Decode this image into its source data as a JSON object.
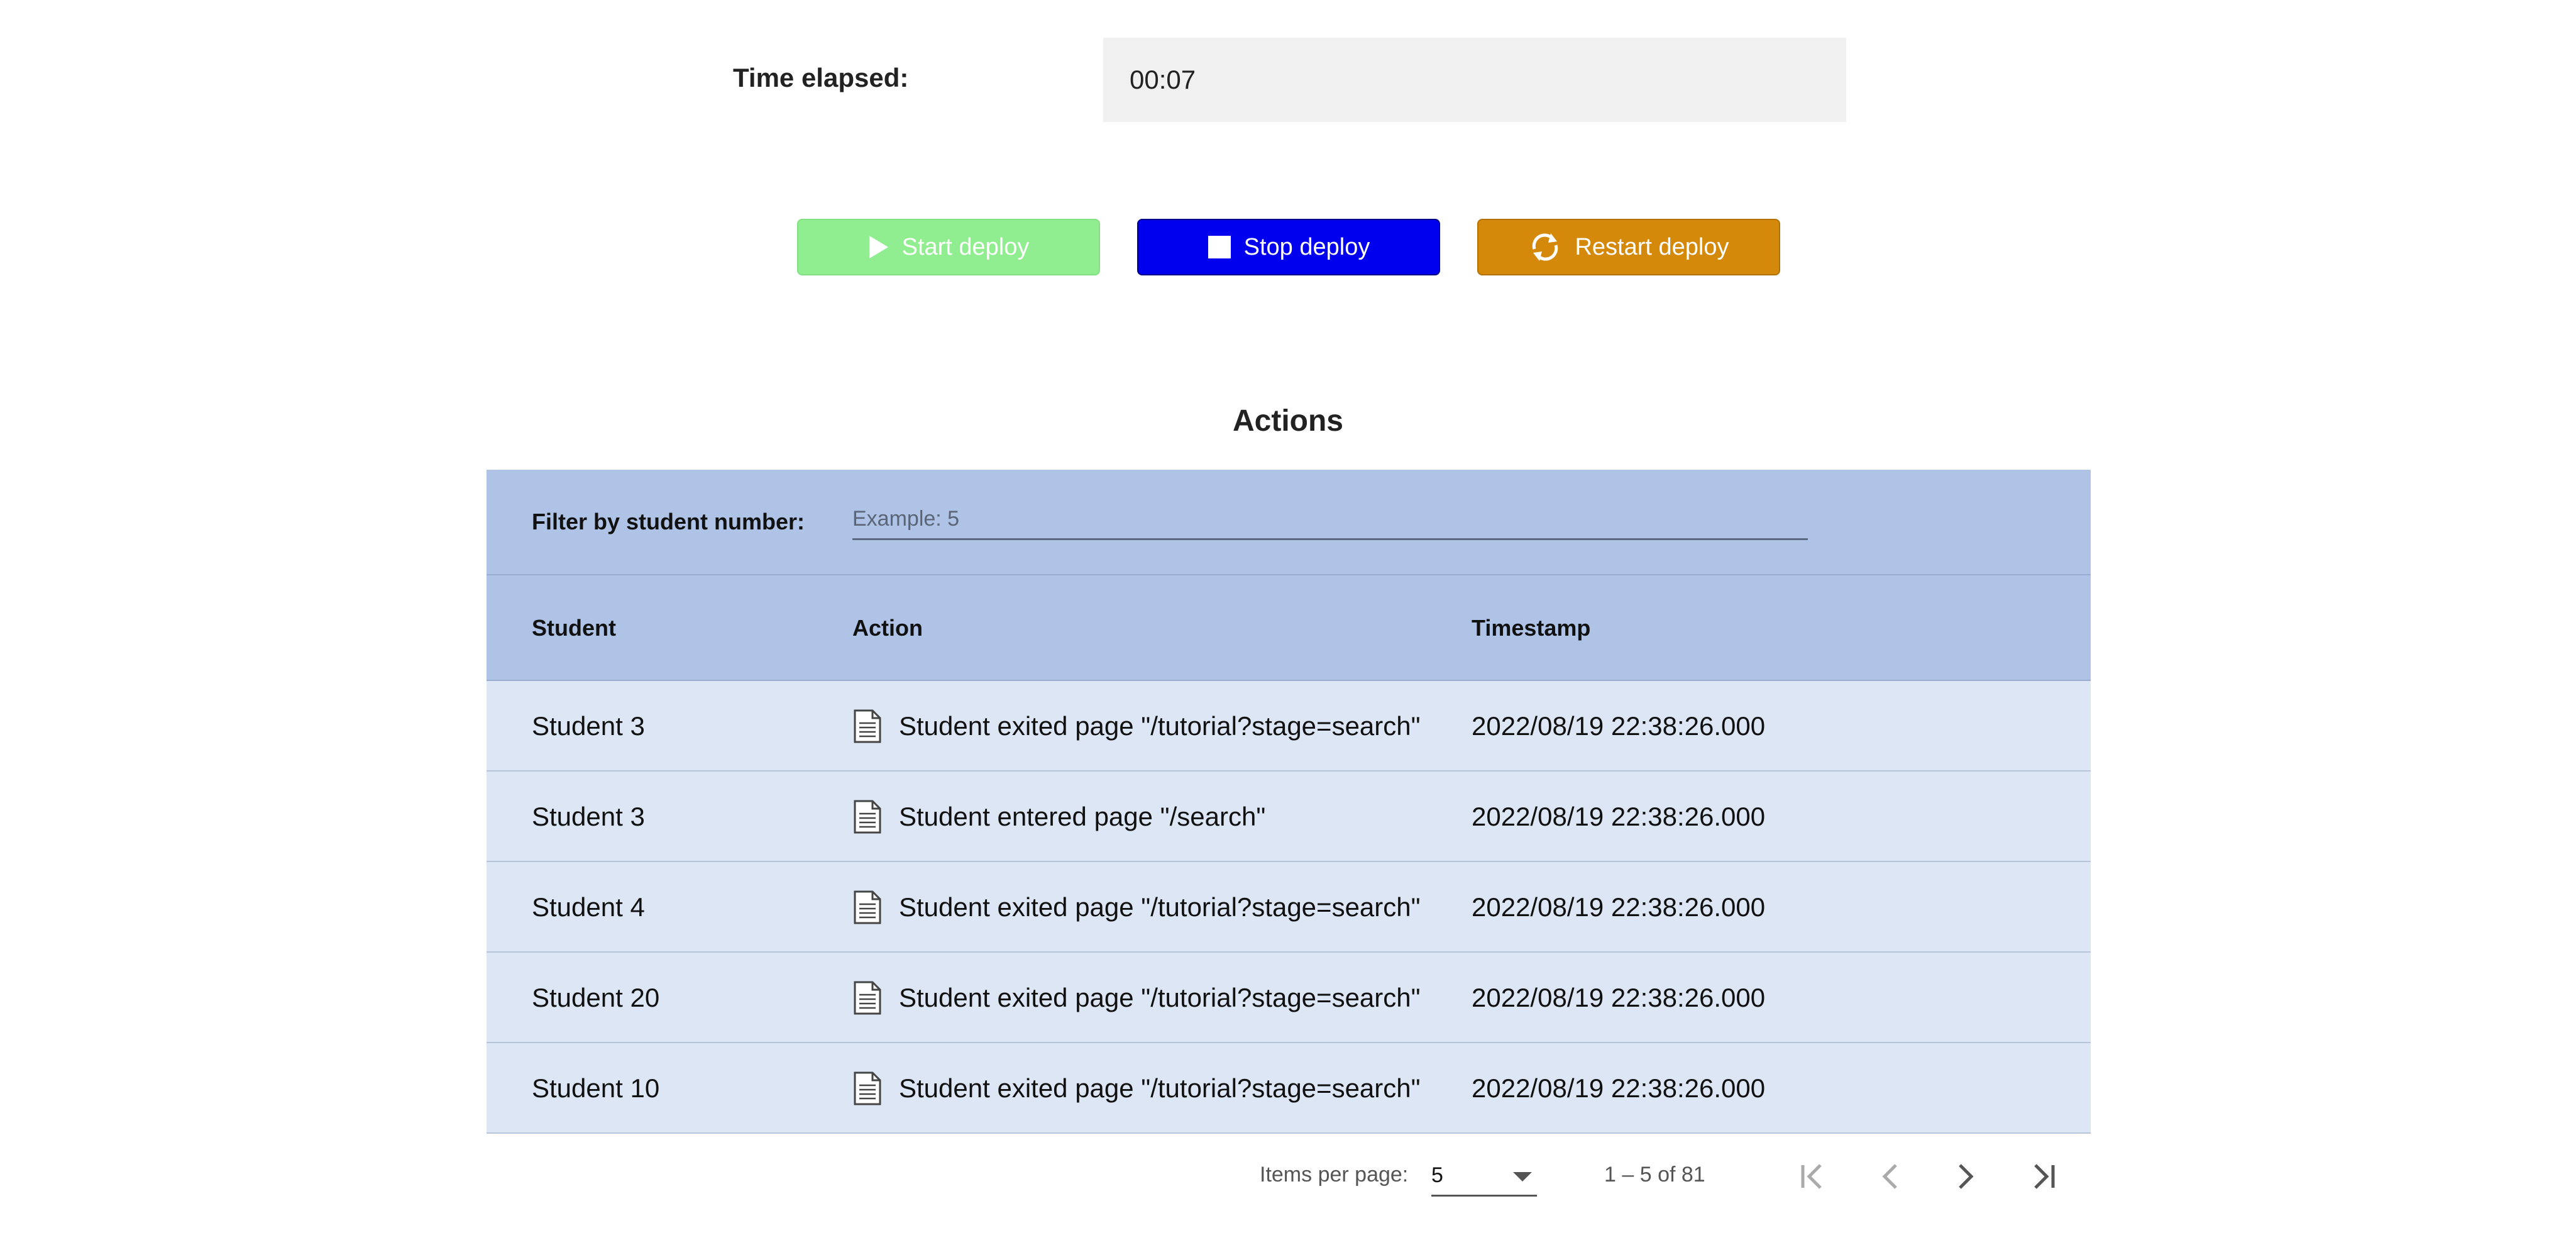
{
  "timer": {
    "label": "Time elapsed:",
    "value": "00:07"
  },
  "buttons": {
    "start": "Start deploy",
    "stop": "Stop deploy",
    "restart": "Restart deploy"
  },
  "actions": {
    "title": "Actions",
    "filter_label": "Filter by student number:",
    "filter_placeholder": "Example: 5",
    "columns": {
      "student": "Student",
      "action": "Action",
      "timestamp": "Timestamp"
    },
    "rows": [
      {
        "student": "Student 3",
        "action": "Student exited page \"/tutorial?stage=search\"",
        "timestamp": "2022/08/19 22:38:26.000",
        "icon": "document-icon"
      },
      {
        "student": "Student 3",
        "action": "Student entered page \"/search\"",
        "timestamp": "2022/08/19 22:38:26.000",
        "icon": "document-icon"
      },
      {
        "student": "Student 4",
        "action": "Student exited page \"/tutorial?stage=search\"",
        "timestamp": "2022/08/19 22:38:26.000",
        "icon": "document-icon"
      },
      {
        "student": "Student 20",
        "action": "Student exited page \"/tutorial?stage=search\"",
        "timestamp": "2022/08/19 22:38:26.000",
        "icon": "document-icon"
      },
      {
        "student": "Student 10",
        "action": "Student exited page \"/tutorial?stage=search\"",
        "timestamp": "2022/08/19 22:38:26.000",
        "icon": "document-icon"
      }
    ]
  },
  "paginator": {
    "items_per_page_label": "Items per page:",
    "items_per_page_value": "5",
    "range": "1 – 5 of 81"
  },
  "colors": {
    "start_button": "#90ee90",
    "stop_button": "#0000ee",
    "restart_button": "#d4890a",
    "table_header": "#aec3e6",
    "table_row": "#dce6f4"
  }
}
